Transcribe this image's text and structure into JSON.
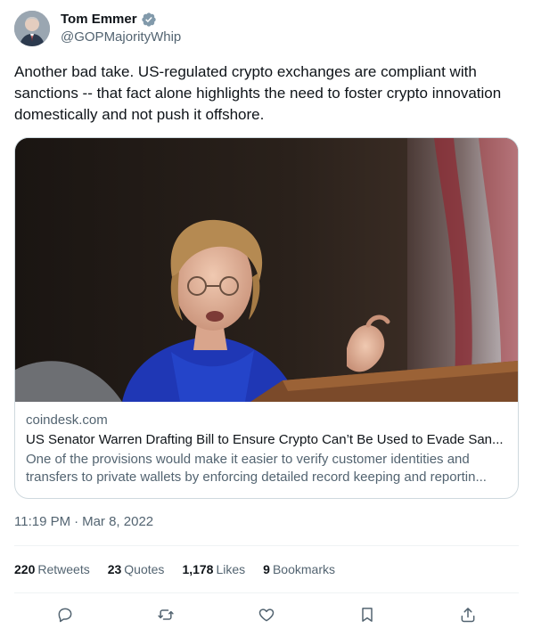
{
  "author": {
    "display_name": "Tom Emmer",
    "handle": "@GOPMajorityWhip",
    "verified": true
  },
  "tweet": {
    "text": "Another bad take. US-regulated crypto exchanges are compliant with sanctions -- that fact alone highlights the need to foster crypto innovation domestically and not push it offshore.",
    "time": "11:19 PM",
    "separator": "·",
    "date": "Mar 8, 2022"
  },
  "card": {
    "domain": "coindesk.com",
    "title": "US Senator Warren Drafting Bill to Ensure Crypto Can’t Be Used to Evade San...",
    "description_line1": "One of the provisions would make it easier to verify customer identities and",
    "description_line2": "transfers to private wallets by enforcing detailed record keeping and reportin..."
  },
  "stats": {
    "retweets_count": "220",
    "retweets_label": "Retweets",
    "quotes_count": "23",
    "quotes_label": "Quotes",
    "likes_count": "1,178",
    "likes_label": "Likes",
    "bookmarks_count": "9",
    "bookmarks_label": "Bookmarks"
  },
  "actions": {
    "reply_icon": "reply-icon",
    "retweet_icon": "retweet-icon",
    "like_icon": "heart-icon",
    "bookmark_icon": "bookmark-icon",
    "share_icon": "share-icon"
  },
  "colors": {
    "text_primary": "#0f1419",
    "text_secondary": "#536471",
    "border": "#cfd9de",
    "divider": "#eff3f4",
    "verified": "#829aab"
  }
}
